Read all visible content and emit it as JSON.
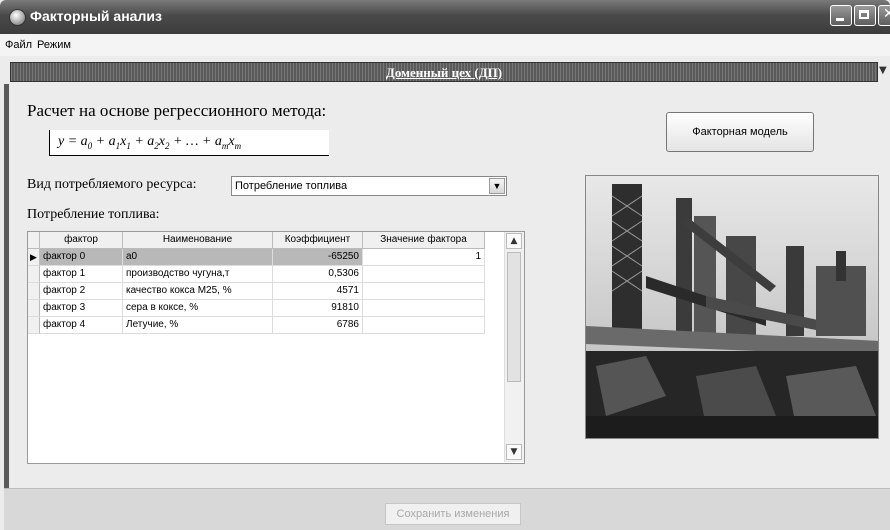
{
  "window": {
    "title": "Факторный анализ"
  },
  "menu": [
    "Файл",
    "Режим"
  ],
  "department": "Доменный цех (ДП)",
  "calc_title": "Расчет на основе регрессионного метода:",
  "formula": {
    "y": "y",
    "eq": "=",
    "plus": "+",
    "a0": "a",
    "sub0": "0",
    "a1": "a",
    "sub1a": "1",
    "x1": "x",
    "sub1x": "1",
    "a2": "a",
    "sub2a": "2",
    "x2": "x",
    "sub2x": "2",
    "ellipsis": "…",
    "am": "a",
    "subma": "m",
    "xm": "x",
    "submx": "m"
  },
  "resource": {
    "label": "Вид потребляемого ресурса:",
    "selected": "Потребление топлива"
  },
  "table_title": "Потребление топлива:",
  "table": {
    "headers": [
      "фактор",
      "Наименование",
      "Коэффициент",
      "Значение фактора"
    ],
    "rows": [
      [
        "фактор 0",
        "a0",
        "-65250",
        "1"
      ],
      [
        "фактор 1",
        "производство чугуна,т",
        "0,5306",
        ""
      ],
      [
        "фактор 2",
        "качество кокса М25, %",
        "4571",
        ""
      ],
      [
        "фактор 3",
        "сера в коксе, %",
        "91810",
        ""
      ],
      [
        "фактор 4",
        "Летучие, %",
        "6786",
        ""
      ]
    ],
    "selected_row": 0
  },
  "factor_model_button": "Факторная модель",
  "save_button": "Сохранить изменения",
  "icons": {
    "app": "app-icon",
    "minimize": "minimize-icon",
    "maximize": "maximize-icon",
    "close": "close-icon",
    "dropdown": "chevron-down-icon",
    "row_pointer": "triangle-right-icon"
  }
}
